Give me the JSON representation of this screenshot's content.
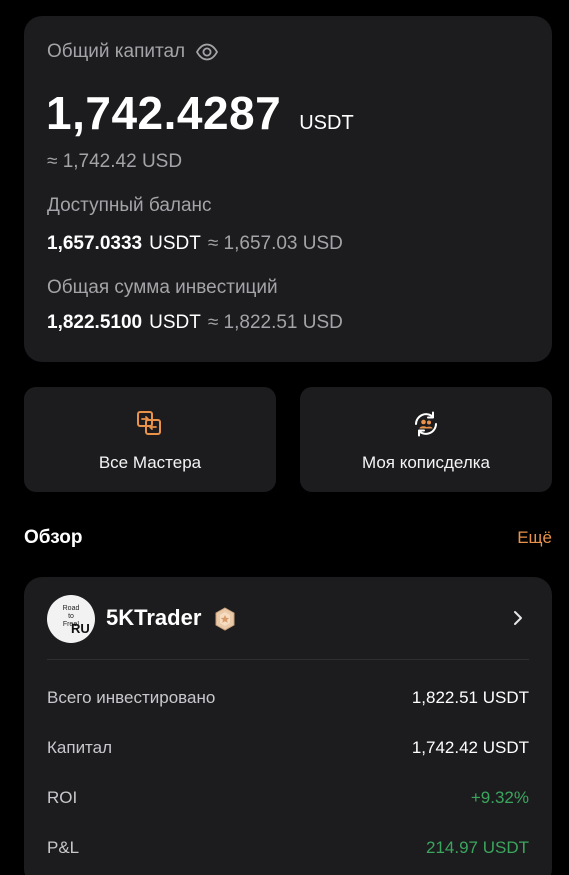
{
  "capital": {
    "title": "Общий капитал",
    "eye_icon": "eye-icon",
    "amount": "1,742.4287",
    "unit": "USDT",
    "approx": "≈ 1,742.42 USD",
    "available": {
      "label": "Доступный баланс",
      "amount": "1,657.0333",
      "unit": "USDT",
      "approx": "≈ 1,657.03 USD"
    },
    "invested": {
      "label": "Общая сумма инвестиций",
      "amount": "1,822.5100",
      "unit": "USDT",
      "approx": "≈ 1,822.51 USD"
    }
  },
  "actions": {
    "masters": {
      "label": "Все Мастера",
      "icon": "swap-icon"
    },
    "copy": {
      "label": "Моя кописделка",
      "icon": "copy-trade-icon"
    }
  },
  "overview": {
    "title": "Обзор",
    "more": "Ещё"
  },
  "trader": {
    "avatar_text": "Road to Free!",
    "avatar_tag": "RU",
    "name": "5KTrader",
    "badge_icon": "medal-badge-icon",
    "rows": [
      {
        "key": "Всего инвестировано",
        "value": "1,822.51 USDT"
      },
      {
        "key": "Капитал",
        "value": "1,742.42 USDT"
      },
      {
        "key": "ROI",
        "value": "+9.32%"
      },
      {
        "key": "P&L",
        "value": "214.97 USDT"
      }
    ]
  },
  "colors": {
    "accent": "#e8924a",
    "positive": "#3ba55d",
    "card": "#1c1c1f",
    "background": "#000000"
  }
}
